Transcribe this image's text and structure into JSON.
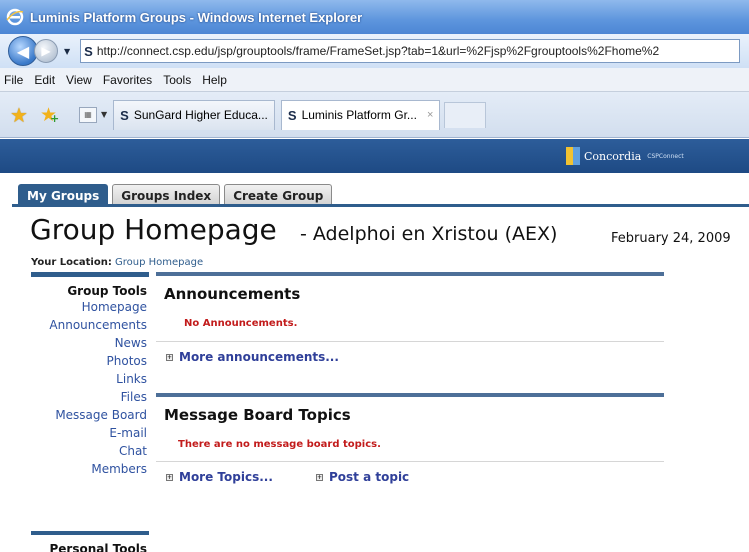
{
  "window": {
    "title": "Luminis Platform Groups - Windows Internet Explorer",
    "icon": "ie-logo-icon"
  },
  "address_bar": {
    "favicon": "S",
    "url": "http://connect.csp.edu/jsp/grouptools/frame/FrameSet.jsp?tab=1&url=%2Fjsp%2Fgrouptools%2Fhome%2"
  },
  "menu": {
    "items": [
      "File",
      "Edit",
      "View",
      "Favorites",
      "Tools",
      "Help"
    ]
  },
  "browser_tabs": [
    {
      "favicon": "S",
      "label": "SunGard Higher Educa...",
      "active": false
    },
    {
      "favicon": "S",
      "label": "Luminis Platform Gr...",
      "active": true,
      "close": "×"
    }
  ],
  "banner": {
    "logo_text": "Concordia",
    "logo_sub": "CSPConnect"
  },
  "group_tabs": [
    "My Groups",
    "Groups Index",
    "Create Group"
  ],
  "page": {
    "title": "Group Homepage",
    "subtitle": "-  Adelphoi en Xristou (AEX)",
    "date": "February 24, 2009",
    "location_label": "Your Location:",
    "location_value": "Group Homepage"
  },
  "tools": {
    "title": "Group Tools",
    "links": [
      "Homepage",
      "Announcements",
      "News",
      "Photos",
      "Links",
      "Files",
      "Message Board",
      "E-mail",
      "Chat",
      "Members"
    ],
    "personal_title": "Personal Tools"
  },
  "announcements": {
    "title": "Announcements",
    "empty": "No Announcements.",
    "more": "More announcements..."
  },
  "message_board": {
    "title": "Message Board Topics",
    "empty": "There are no message board topics.",
    "more": "More Topics...",
    "post": "Post a topic"
  }
}
